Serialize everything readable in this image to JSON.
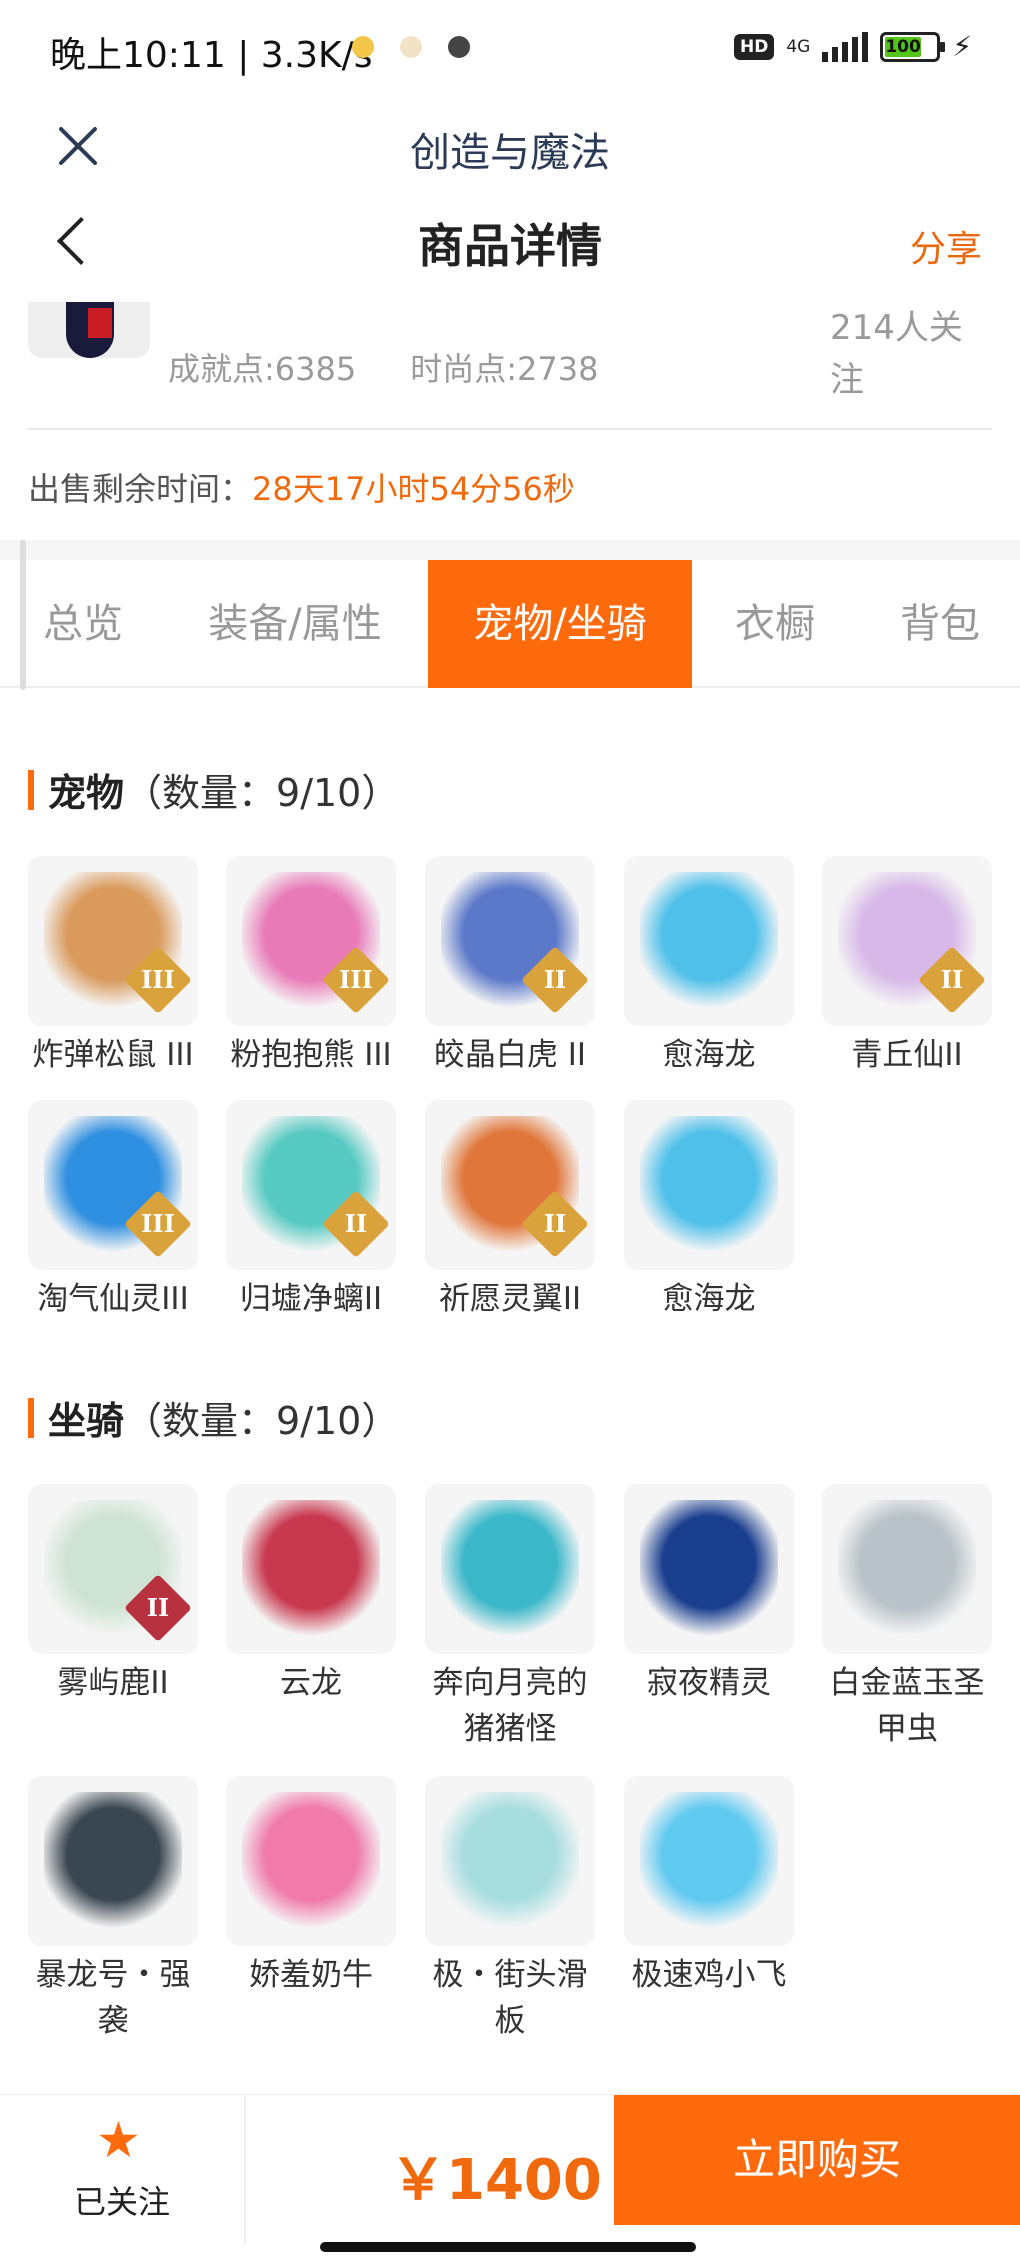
{
  "status_bar": {
    "time_speed": "晚上10:11 | 3.3K/s",
    "hd": "HD",
    "network": "4G",
    "battery": "100"
  },
  "app_bar": {
    "title": "创造与魔法"
  },
  "page_header": {
    "title": "商品详情",
    "share_label": "分享"
  },
  "seller": {
    "achievement": "成就点:6385",
    "fashion": "时尚点:2738",
    "followers": "214人关注"
  },
  "sale": {
    "remaining_label": "出售剩余时间：",
    "countdown": "28天17小时54分56秒"
  },
  "tabs": [
    {
      "label": "总览",
      "active": false
    },
    {
      "label": "装备/属性",
      "active": false
    },
    {
      "label": "宠物/坐骑",
      "active": true
    },
    {
      "label": "衣橱",
      "active": false
    },
    {
      "label": "背包",
      "active": false
    }
  ],
  "pets": {
    "title": "宠物",
    "count": "（数量：9/10）",
    "items": [
      {
        "name": "炸弹松鼠 III",
        "badge": "III",
        "icon": "squirrel-pet-icon",
        "color": "#d99a5c"
      },
      {
        "name": "粉抱抱熊 III",
        "badge": "III",
        "icon": "pink-bear-pet-icon",
        "color": "#e87ab8"
      },
      {
        "name": "皎晶白虎 II",
        "badge": "II",
        "icon": "white-tiger-pet-icon",
        "color": "#5b78c9"
      },
      {
        "name": "愈海龙",
        "badge": "",
        "icon": "sea-dragon-pet-icon",
        "color": "#4fc0ea"
      },
      {
        "name": "青丘仙II",
        "badge": "II",
        "icon": "fox-fairy-pet-icon",
        "color": "#d7b8e8"
      },
      {
        "name": "淘气仙灵III",
        "badge": "III",
        "icon": "blue-sprite-pet-icon",
        "color": "#2f8fe0"
      },
      {
        "name": "归墟净螭II",
        "badge": "II",
        "icon": "jade-dragon-pet-icon",
        "color": "#56c9c2"
      },
      {
        "name": "祈愿灵翼II",
        "badge": "II",
        "icon": "phoenix-bird-pet-icon",
        "color": "#e0763a"
      },
      {
        "name": "愈海龙",
        "badge": "",
        "icon": "sea-dragon-pet-icon",
        "color": "#4fc0ea"
      }
    ]
  },
  "mounts": {
    "title": "坐骑",
    "count": "（数量：9/10）",
    "items": [
      {
        "name": "雾屿鹿II",
        "badge": "II",
        "icon": "deer-mount-icon",
        "color": "#cfe3d4"
      },
      {
        "name": "云龙",
        "badge": "",
        "icon": "cloud-dragon-mount-icon",
        "color": "#c8394f"
      },
      {
        "name": "奔向月亮的猪猪怪",
        "badge": "",
        "icon": "moon-pig-mount-icon",
        "color": "#3ab7c8"
      },
      {
        "name": "寂夜精灵",
        "badge": "",
        "icon": "night-spirit-mount-icon",
        "color": "#1b3f8f"
      },
      {
        "name": "白金蓝玉圣甲虫",
        "badge": "",
        "icon": "scarab-mount-icon",
        "color": "#b8c2c8"
      },
      {
        "name": "暴龙号・强袭",
        "badge": "",
        "icon": "mech-dino-mount-icon",
        "color": "#3a4650"
      },
      {
        "name": "娇羞奶牛",
        "badge": "",
        "icon": "shy-cow-mount-icon",
        "color": "#f07aa8"
      },
      {
        "name": "极・街头滑板",
        "badge": "",
        "icon": "skateboard-mount-icon",
        "color": "#a8dde0"
      },
      {
        "name": "极速鸡小飞",
        "badge": "",
        "icon": "speed-chick-mount-icon",
        "color": "#5fc9f0"
      }
    ]
  },
  "bottom_bar": {
    "follow_label": "已关注",
    "price": "￥1400",
    "buy_label": "立即购买"
  },
  "colors": {
    "accent": "#ff6a0c",
    "countdown": "#f06a0d",
    "muted": "#9a9a9a"
  }
}
